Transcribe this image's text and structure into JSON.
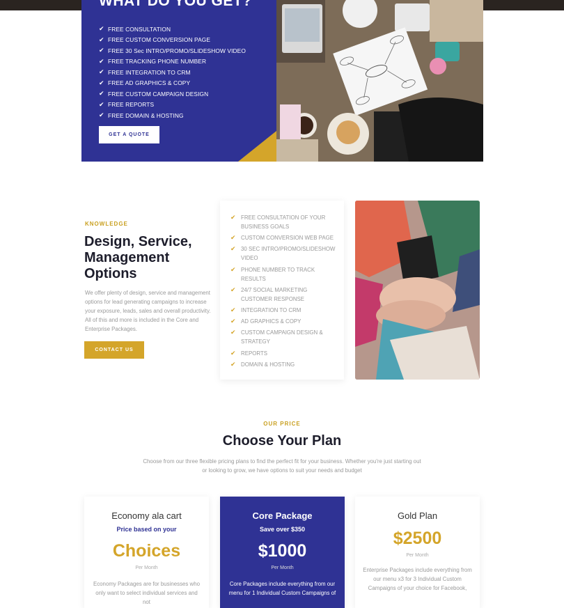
{
  "hero": {
    "title": "WHAT DO YOU GET?",
    "items": [
      "FREE CONSULTATION",
      "FREE CUSTOM CONVERSION PAGE",
      "FREE 30 Sec INTRO/PROMO/SLIDESHOW VIDEO",
      "FREE TRACKING PHONE NUMBER",
      "FREE INTEGRATION TO CRM",
      "FREE AD GRAPHICS & COPY",
      "FREE CUSTOM CAMPAIGN DESIGN",
      "FREE REPORTS",
      "FREE DOMAIN & HOSTING"
    ],
    "button": "GET A QUOTE",
    "accent": "#2f3294",
    "gold": "#d4a52a"
  },
  "knowledge": {
    "label": "KNOWLEDGE",
    "title": "Design, Service, Management Options",
    "description": "We offer plenty of design, service and management options for lead generating campaigns to increase your exposure, leads, sales and overall productivity. All of this and more is included in the Core and Enterprise Packages.",
    "button": "CONTACT US",
    "features": [
      "FREE CONSULTATION OF YOUR BUSINESS GOALS",
      "CUSTOM CONVERSION WEB PAGE",
      "30 SEC INTRO/PROMO/SLIDESHOW VIDEO",
      "PHONE NUMBER TO TRACK RESULTS",
      "24/7 SOCIAL MARKETING CUSTOMER RESPONSE",
      "INTEGRATION TO CRM",
      "AD GRAPHICS & COPY",
      "CUSTOM CAMPAIGN DESIGN & STRATEGY",
      "REPORTS",
      "DOMAIN & HOSTING"
    ]
  },
  "pricing": {
    "label": "OUR PRICE",
    "title": "Choose Your Plan",
    "description": "Choose from our three flexible pricing plans to find the perfect fit for your business. Whether you're just starting out or looking to grow, we have options to suit your needs and budget",
    "plans": [
      {
        "name": "Economy ala cart",
        "subtitle": "Price based on your",
        "price": "Choices",
        "period": "Per Month",
        "description": "Economy Packages are for businesses who only want to select individual services and not"
      },
      {
        "name": "Core Package",
        "subtitle": "Save over $350",
        "price": "$1000",
        "period": "Per Month",
        "description": "Core Packages include everything from our menu for 1 Individual Custom Campaigns of"
      },
      {
        "name": "Gold Plan",
        "subtitle": "",
        "price": "$2500",
        "period": "Per Month",
        "description": "Enterprise Packages include everything from our menu x3 for 3 Individual Custom Campaigns of your choice for Facebook,"
      }
    ]
  }
}
